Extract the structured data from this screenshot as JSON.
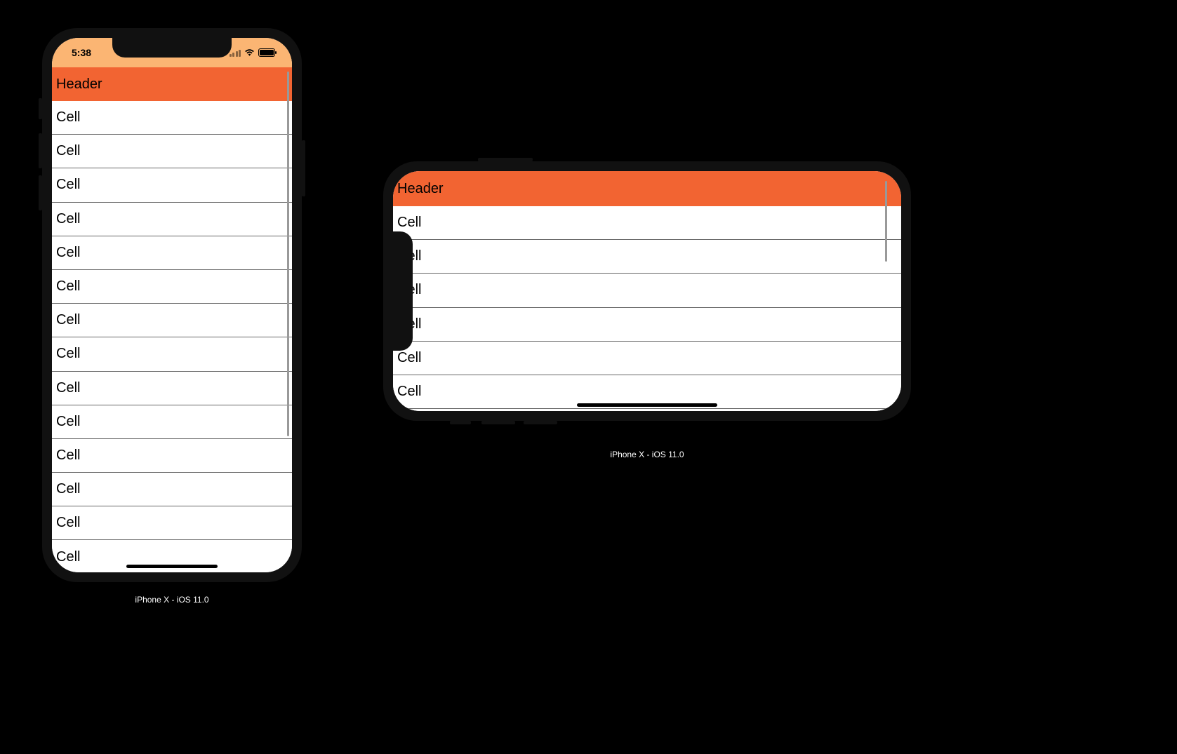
{
  "portrait": {
    "caption": "iPhone X - iOS 11.0",
    "status_time": "5:38",
    "header_label": "Header",
    "cells": [
      "Cell",
      "Cell",
      "Cell",
      "Cell",
      "Cell",
      "Cell",
      "Cell",
      "Cell",
      "Cell",
      "Cell",
      "Cell",
      "Cell",
      "Cell",
      "Cell"
    ]
  },
  "landscape": {
    "caption": "iPhone X - iOS 11.0",
    "header_label": "Header",
    "cells": [
      "Cell",
      "Cell",
      "Cell",
      "Cell",
      "Cell",
      "Cell"
    ]
  },
  "colors": {
    "status_bg": "#fbb573",
    "header_bg": "#f26432"
  }
}
